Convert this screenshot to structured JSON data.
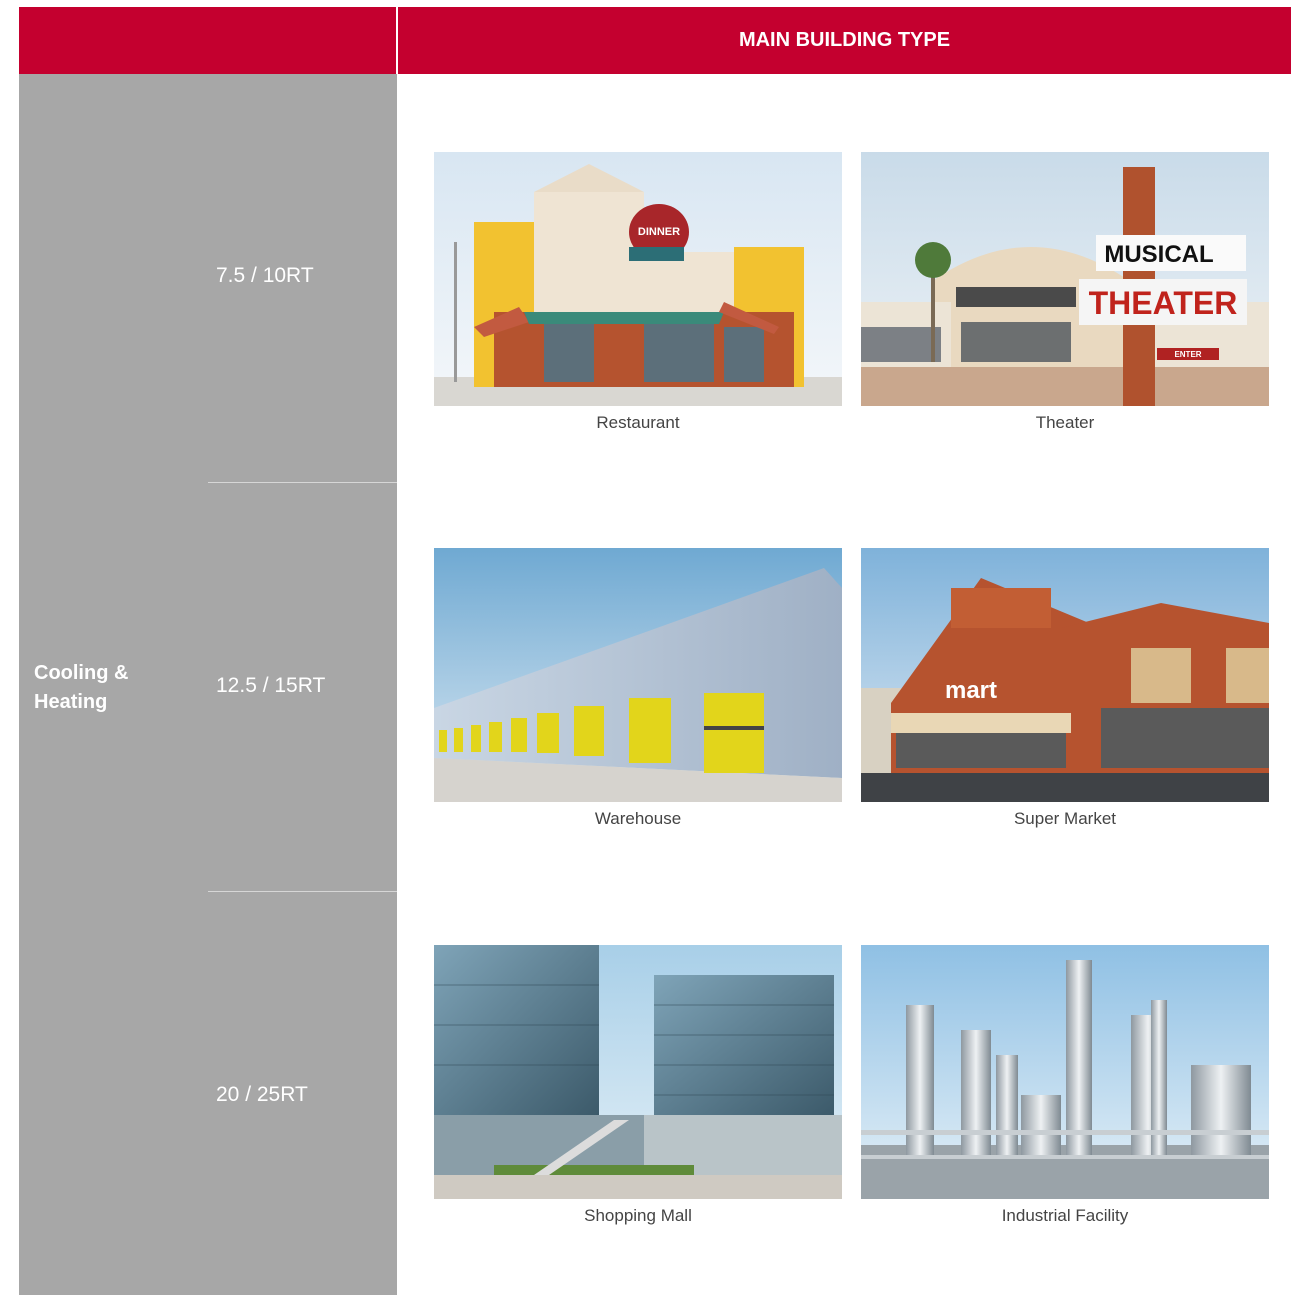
{
  "header": {
    "title": "MAIN BUILDING TYPE"
  },
  "category": {
    "label_line1": "Cooling &",
    "label_line2": "Heating"
  },
  "capacities": [
    "7.5 / 10RT",
    "12.5 / 15RT",
    "20 / 25RT"
  ],
  "buildings": {
    "restaurant": "Restaurant",
    "theater": "Theater",
    "warehouse": "Warehouse",
    "supermarket": "Super Market",
    "mall": "Shopping Mall",
    "industrial": "Industrial Facility"
  },
  "signage": {
    "dinner": "DINNER",
    "musical": "MUSICAL",
    "theater": "THEATER",
    "enter": "ENTER",
    "mart": "mart"
  },
  "colors": {
    "brand_red": "#c4002f",
    "side_gray": "#a7a7a7"
  }
}
